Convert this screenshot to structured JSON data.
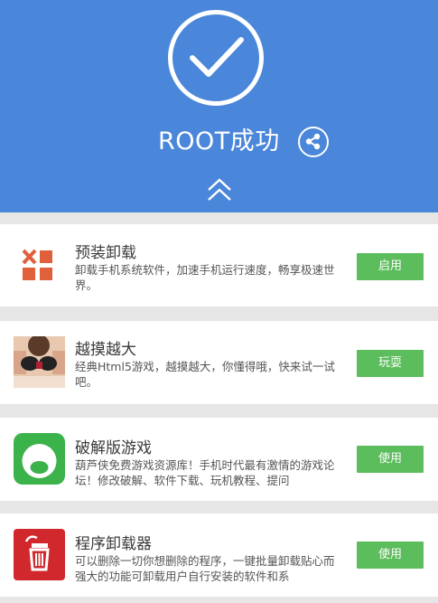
{
  "header": {
    "title": "ROOT成功",
    "icons": {
      "status": "check-circle-icon",
      "share": "share-icon",
      "collapse": "double-chevron-up-icon"
    },
    "colors": {
      "background": "#4a86d9",
      "foreground": "#ffffff"
    }
  },
  "apps": [
    {
      "name": "预装卸载",
      "desc": "卸载手机系统软件，加速手机运行速度，畅享极速世界。",
      "button": "启用",
      "icon": "preinstall-uninstall-icon"
    },
    {
      "name": "越摸越大",
      "desc": "经典Html5游戏，越摸越大，你懂得哦，快来试一试吧。",
      "button": "玩耍",
      "icon": "game-thumbnail-icon"
    },
    {
      "name": "破解版游戏",
      "desc": "葫芦侠免费游戏资源库！手机时代最有激情的游戏论坛！修改破解、软件下载、玩机教程、提问",
      "button": "使用",
      "icon": "gourd-app-icon"
    },
    {
      "name": "程序卸载器",
      "desc": "可以删除一切你想删除的程序，一键批量卸载贴心而强大的功能可卸载用户自行安装的软件和系",
      "button": "使用",
      "icon": "trash-uninstaller-icon"
    }
  ],
  "colors": {
    "button": "#5cbd5c",
    "page_background": "#e6e6e6"
  }
}
